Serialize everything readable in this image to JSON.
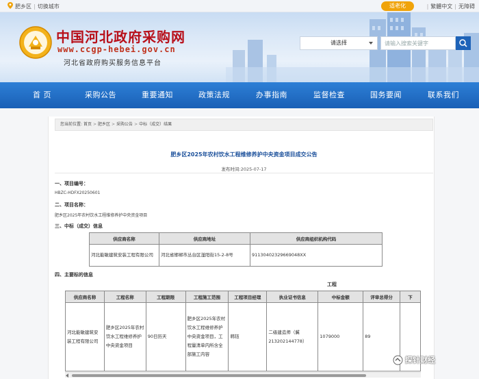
{
  "topbar": {
    "location": "肥乡区",
    "switch_city": "切换城市",
    "elder_mode": "适老化",
    "traditional": "繁體中文",
    "accessibility": "无障碍"
  },
  "header": {
    "site_title": "中国河北政府采购网",
    "site_url": "www.ccgp-hebei.gov.cn",
    "site_subtitle": "河北省政府购买服务信息平台",
    "search_select": "请选择",
    "search_placeholder": "请输入搜索关键字"
  },
  "nav": [
    "首 页",
    "采购公告",
    "重要通知",
    "政策法规",
    "办事指南",
    "监督检查",
    "国务要闻",
    "联系我们"
  ],
  "breadcrumb": {
    "prefix": "您当前位置:",
    "items": [
      "首页",
      "肥乡区",
      "采购公告",
      "中标（成交）结果"
    ]
  },
  "article": {
    "title": "肥乡区2025年农村饮水工程维修养护中央资金项目成交公告",
    "publish_label": "发布时间:",
    "publish_date": "2025-07-17",
    "sec1_title": "一、项目编号：",
    "sec1_value": "HBZC-HDFX20250601",
    "sec2_title": "二、项目名称：",
    "sec2_value": "肥乡区2025年农村饮水工程维修养护中央资金项目",
    "sec3_title": "三、中标（成交）信息",
    "sec4_title": "四、主要标的信息",
    "engineering_label": "工程"
  },
  "supplier_table": {
    "headers": [
      "供应商名称",
      "供应商地址",
      "供应商组织机构代码"
    ],
    "row": [
      "河北能敏建筑安装工程有限公司",
      "河北省邯郸市丛台区滏阳街15-2-8号",
      "91130402329669048XX"
    ]
  },
  "subject_table": {
    "headers": [
      "供应商名称",
      "工程名称",
      "工程期限",
      "工程施工范围",
      "工程项目经理",
      "执业证书信息",
      "中标金额",
      "评审总得分",
      "下"
    ],
    "row": [
      "河北能敏建筑安装工程有限公司",
      "肥乡区2025年农村饮水工程维修养护中央资金项目",
      "90日历天",
      "肥乡区2025年农村饮水工程维修养护中央资金项目，工程量清单内所含全部施工内容",
      "韩钰",
      "二级建造师（冀213202144778）",
      "1079000",
      "89",
      ""
    ]
  },
  "watermark": "探针财经",
  "colors": {
    "nav": "#1a60b6",
    "title_red": "#b8101a",
    "accent_orange": "#f0a30a",
    "article_title": "#1a4f9a"
  }
}
